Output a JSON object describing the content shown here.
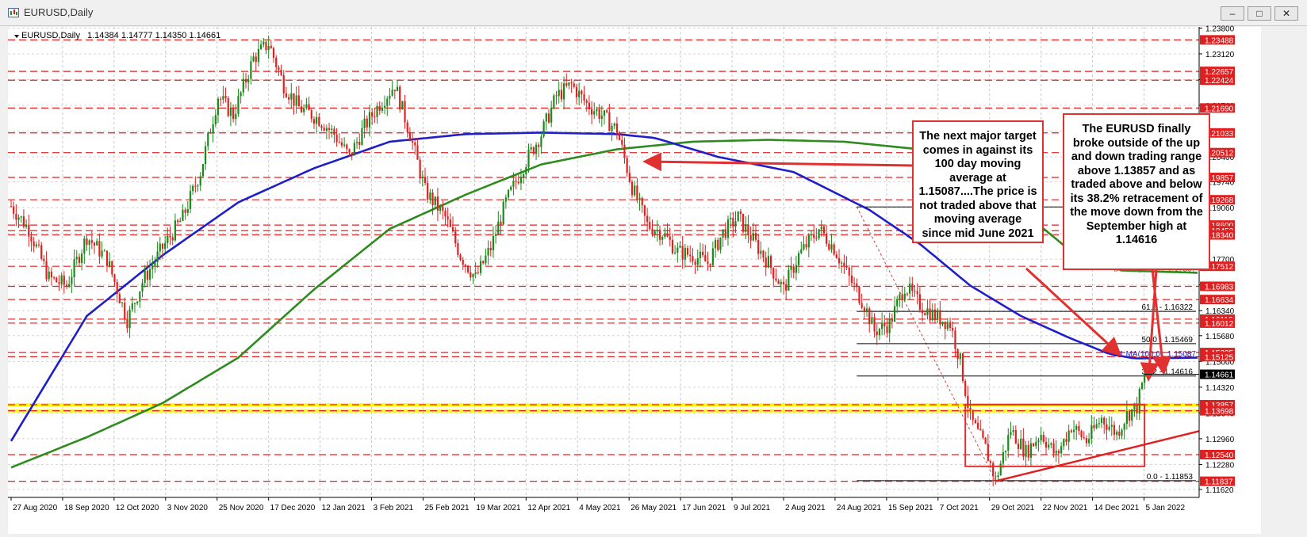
{
  "window": {
    "title": "EURUSD,Daily",
    "buttons": {
      "minimize": "–",
      "maximize": "□",
      "close": "✕"
    }
  },
  "header": {
    "symbol": "EURUSD,Daily",
    "ohlc": "1.14384 1.14777 1.14350 1.14661"
  },
  "annotations": {
    "box1": "The next major target comes in against its 100 day moving average at 1.15087....The price is not traded above that moving average since mid June 2021",
    "box2": "The EURUSD finally broke outside of the up and down trading range above 1.13857 and as traded above and below its 38.2% retracement of the move down from the September high at 1.14616"
  },
  "colors": {
    "background": "#ffffff",
    "bull": "#1a8a1a",
    "bear": "#e02020",
    "ma100": "#1f1fc8",
    "ma200": "#2e8b1f",
    "level": "#e02020",
    "highlight": "#ffff00",
    "current_price": "#000000"
  },
  "chart_data": {
    "type": "candlestick",
    "symbol": "EURUSD",
    "timeframe": "Daily",
    "ylim": [
      1.1162,
      1.2383
    ],
    "y_ticks": [
      "1.23800",
      "1.23120",
      "1.22440",
      "1.21760",
      "1.21080",
      "1.20400",
      "1.19740",
      "1.19060",
      "1.18380",
      "1.17700",
      "1.17020",
      "1.16340",
      "1.15680",
      "1.15000",
      "1.14320",
      "1.13640",
      "1.12960",
      "1.12280",
      "1.11620"
    ],
    "x_labels": [
      "27 Aug 2020",
      "18 Sep 2020",
      "12 Oct 2020",
      "3 Nov 2020",
      "25 Nov 2020",
      "17 Dec 2020",
      "12 Jan 2021",
      "3 Feb 2021",
      "25 Feb 2021",
      "19 Mar 2021",
      "12 Apr 2021",
      "4 May 2021",
      "26 May 2021",
      "17 Jun 2021",
      "9 Jul 2021",
      "2 Aug 2021",
      "24 Aug 2021",
      "15 Sep 2021",
      "7 Oct 2021",
      "29 Oct 2021",
      "22 Nov 2021",
      "14 Dec 2021",
      "5 Jan 2022"
    ],
    "price_path": [
      [
        0,
        1.191
      ],
      [
        7,
        1.185
      ],
      [
        15,
        1.172
      ],
      [
        22,
        1.17
      ],
      [
        30,
        1.183
      ],
      [
        38,
        1.177
      ],
      [
        46,
        1.161
      ],
      [
        52,
        1.171
      ],
      [
        60,
        1.18
      ],
      [
        68,
        1.188
      ],
      [
        75,
        1.2
      ],
      [
        82,
        1.22
      ],
      [
        88,
        1.215
      ],
      [
        96,
        1.23
      ],
      [
        102,
        1.234
      ],
      [
        108,
        1.223
      ],
      [
        114,
        1.217
      ],
      [
        122,
        1.214
      ],
      [
        128,
        1.21
      ],
      [
        134,
        1.204
      ],
      [
        140,
        1.212
      ],
      [
        146,
        1.218
      ],
      [
        152,
        1.223
      ],
      [
        158,
        1.21
      ],
      [
        164,
        1.195
      ],
      [
        172,
        1.188
      ],
      [
        178,
        1.178
      ],
      [
        184,
        1.172
      ],
      [
        190,
        1.18
      ],
      [
        196,
        1.192
      ],
      [
        204,
        1.203
      ],
      [
        210,
        1.21
      ],
      [
        216,
        1.22
      ],
      [
        222,
        1.223
      ],
      [
        228,
        1.218
      ],
      [
        234,
        1.215
      ],
      [
        240,
        1.211
      ],
      [
        246,
        1.196
      ],
      [
        252,
        1.186
      ],
      [
        258,
        1.184
      ],
      [
        264,
        1.179
      ],
      [
        270,
        1.178
      ],
      [
        276,
        1.176
      ],
      [
        282,
        1.184
      ],
      [
        288,
        1.188
      ],
      [
        294,
        1.182
      ],
      [
        300,
        1.176
      ],
      [
        306,
        1.169
      ],
      [
        312,
        1.178
      ],
      [
        320,
        1.185
      ],
      [
        326,
        1.18
      ],
      [
        332,
        1.172
      ],
      [
        338,
        1.165
      ],
      [
        342,
        1.158
      ],
      [
        348,
        1.16
      ],
      [
        354,
        1.17
      ],
      [
        360,
        1.165
      ],
      [
        366,
        1.162
      ],
      [
        372,
        1.16
      ],
      [
        376,
        1.15
      ],
      [
        380,
        1.135
      ],
      [
        386,
        1.127
      ],
      [
        390,
        1.1186
      ],
      [
        396,
        1.132
      ],
      [
        402,
        1.126
      ],
      [
        408,
        1.131
      ],
      [
        414,
        1.125
      ],
      [
        420,
        1.133
      ],
      [
        426,
        1.129
      ],
      [
        432,
        1.135
      ],
      [
        438,
        1.131
      ],
      [
        442,
        1.136
      ],
      [
        446,
        1.138
      ],
      [
        449,
        1.1466
      ]
    ],
    "ma100": [
      [
        0,
        1.129
      ],
      [
        30,
        1.162
      ],
      [
        60,
        1.178
      ],
      [
        90,
        1.192
      ],
      [
        120,
        1.201
      ],
      [
        150,
        1.208
      ],
      [
        180,
        1.21
      ],
      [
        210,
        1.2104
      ],
      [
        240,
        1.21
      ],
      [
        255,
        1.209
      ],
      [
        280,
        1.204
      ],
      [
        310,
        1.2
      ],
      [
        340,
        1.19
      ],
      [
        360,
        1.181
      ],
      [
        380,
        1.17
      ],
      [
        400,
        1.162
      ],
      [
        420,
        1.156
      ],
      [
        435,
        1.152
      ],
      [
        445,
        1.1508
      ],
      [
        470,
        1.151
      ]
    ],
    "ma200": [
      [
        0,
        1.122
      ],
      [
        30,
        1.13
      ],
      [
        60,
        1.139
      ],
      [
        90,
        1.151
      ],
      [
        120,
        1.169
      ],
      [
        150,
        1.185
      ],
      [
        180,
        1.194
      ],
      [
        210,
        1.202
      ],
      [
        240,
        1.206
      ],
      [
        270,
        1.208
      ],
      [
        300,
        1.2085
      ],
      [
        330,
        1.208
      ],
      [
        360,
        1.206
      ],
      [
        380,
        1.202
      ],
      [
        400,
        1.19
      ],
      [
        420,
        1.179
      ],
      [
        440,
        1.174
      ],
      [
        470,
        1.1734
      ]
    ],
    "levels": [
      {
        "value": 1.23488,
        "label": "1.23488"
      },
      {
        "value": 1.22657,
        "label": "1.22657"
      },
      {
        "value": 1.22424,
        "label": "1.22424"
      },
      {
        "value": 1.2169,
        "label": "1.21690"
      },
      {
        "value": 1.21033,
        "label": "1.21033"
      },
      {
        "value": 1.20512,
        "label": "1.20512"
      },
      {
        "value": 1.19857,
        "label": "1.19857"
      },
      {
        "value": 1.19268,
        "label": "1.19268"
      },
      {
        "value": 1.186,
        "label": "1.18600"
      },
      {
        "value": 1.18452,
        "label": "1.18452"
      },
      {
        "value": 1.1834,
        "label": "1.18340"
      },
      {
        "value": 1.17512,
        "label": "1.17512"
      },
      {
        "value": 1.16983,
        "label": "1.16983"
      },
      {
        "value": 1.16634,
        "label": "1.16634"
      },
      {
        "value": 1.16116,
        "label": "1.16116"
      },
      {
        "value": 1.16012,
        "label": "1.16012"
      },
      {
        "value": 1.15235,
        "label": "1.15235"
      },
      {
        "value": 1.15125,
        "label": "1.15125"
      },
      {
        "value": 1.13857,
        "label": "1.13857"
      },
      {
        "value": 1.13698,
        "label": "1.13698"
      },
      {
        "value": 1.1254,
        "label": "1.12540"
      },
      {
        "value": 1.11837,
        "label": "1.11837"
      }
    ],
    "highlight_levels": [
      1.13857,
      1.13698
    ],
    "ma_labels": [
      {
        "value": 1.17337,
        "label": "D1 MA(200,0): 1.17337"
      },
      {
        "value": 1.15087,
        "label": "D1 MA(100,0): 1.15087"
      }
    ],
    "fib": {
      "high": 1.1908,
      "low": 1.11853,
      "levels": [
        {
          "value": 1.16322,
          "label": "61.8 - 1.16322"
        },
        {
          "value": 1.15469,
          "label": "50.0 - 1.15469"
        },
        {
          "value": 1.14616,
          "label": "38.2 - 1.14616"
        },
        {
          "value": 1.11853,
          "label": "0.0 - 1.11853"
        }
      ]
    },
    "range_box": {
      "top": 1.1386,
      "bottom": 1.1223
    },
    "current_price": {
      "value": 1.14661,
      "label": "1.14661"
    }
  }
}
